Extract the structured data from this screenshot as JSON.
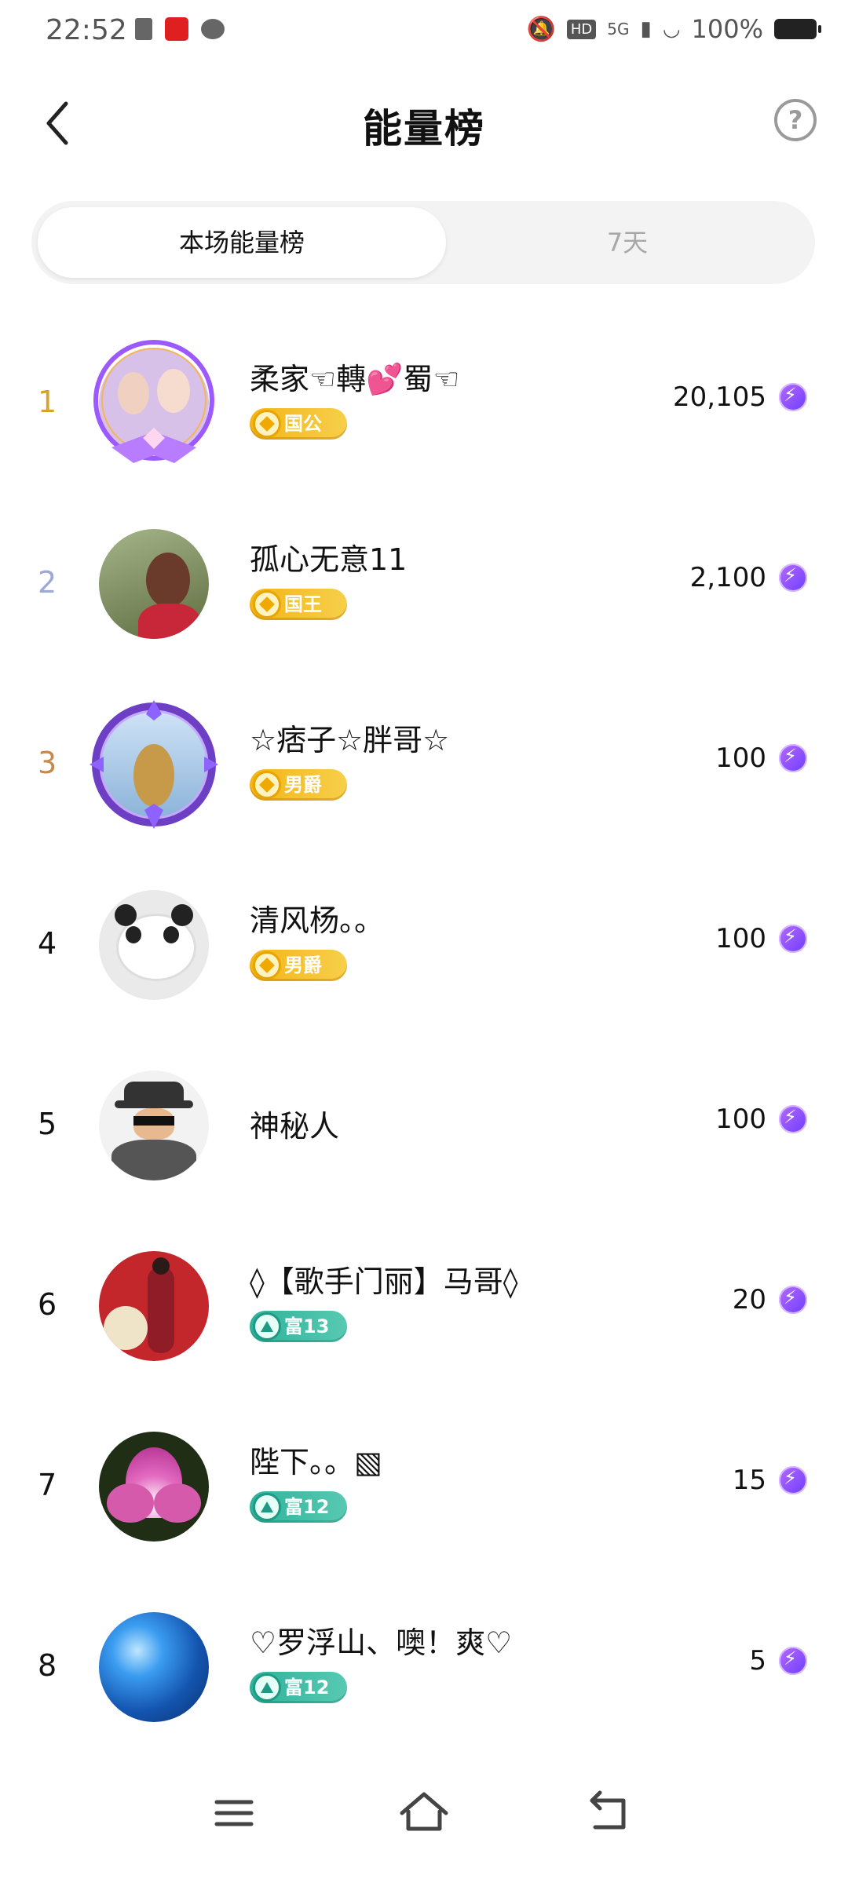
{
  "status": {
    "time": "22:52",
    "network": "5G",
    "hd": "HD",
    "battery": "100%"
  },
  "header": {
    "title": "能量榜",
    "help_symbol": "?"
  },
  "tabs": [
    {
      "label": "本场能量榜",
      "active": true
    },
    {
      "label": "7天",
      "active": false
    }
  ],
  "list": [
    {
      "rank": "1",
      "name": "柔家☜轉💕蜀☜",
      "badge": "国公",
      "badge_type": "gold",
      "score": "20,105",
      "avatar_bg": "#d8c1e8"
    },
    {
      "rank": "2",
      "name": "孤心无意11",
      "badge": "国王",
      "badge_type": "gold",
      "score": "2,100",
      "avatar_bg": "#7c8e62"
    },
    {
      "rank": "3",
      "name": "☆痞子☆胖哥☆",
      "badge": "男爵",
      "badge_type": "gold",
      "score": "100",
      "avatar_bg": "#9fc3e6"
    },
    {
      "rank": "4",
      "name": "清风杨。。",
      "badge": "男爵",
      "badge_type": "gold",
      "score": "100",
      "avatar_bg": "#e9e9e9"
    },
    {
      "rank": "5",
      "name": "神秘人",
      "badge": "",
      "badge_type": "",
      "score": "100",
      "avatar_bg": "#f2f2f2"
    },
    {
      "rank": "6",
      "name": "◊【歌手门丽】马哥◊",
      "badge": "富13",
      "badge_type": "teal",
      "score": "20",
      "avatar_bg": "#c3262b"
    },
    {
      "rank": "7",
      "name": "陛下。。▧",
      "badge": "富12",
      "badge_type": "teal",
      "score": "15",
      "avatar_bg": "#2b3a1d"
    },
    {
      "rank": "8",
      "name": "♡罗浮山、噢！爽♡",
      "badge": "富12",
      "badge_type": "teal",
      "score": "5",
      "avatar_bg": "#1e6dd3"
    }
  ],
  "colors": {
    "rank1": "#d6a42a",
    "rank2": "#9ea7d6",
    "rank3": "#c8884a",
    "energy": "#7a3dff"
  },
  "icons": {
    "back": "chevron-left-icon",
    "help": "question-circle-icon",
    "energy": "lightning-icon",
    "nav_menu": "menu-icon",
    "nav_home": "home-icon",
    "nav_back": "back-arrow-icon"
  }
}
